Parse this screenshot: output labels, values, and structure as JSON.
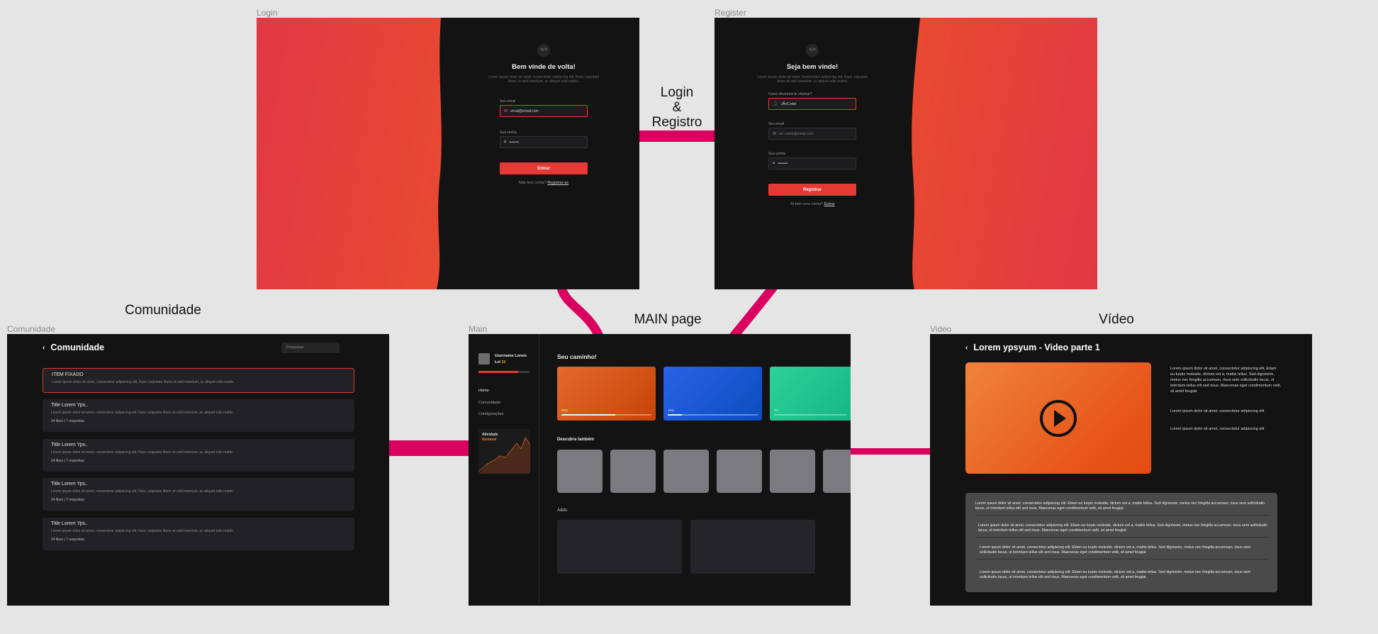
{
  "frames": {
    "login": "Login",
    "register": "Register",
    "community": "Comunidade",
    "main": "Main",
    "video": "Video"
  },
  "annotations": {
    "login_registro": [
      "Login",
      "&",
      "Registro"
    ],
    "comunidade": "Comunidade",
    "main_page": "MAIN page",
    "video": "Vídeo"
  },
  "colors": {
    "accent": "#e53935",
    "connector": "#d9005f",
    "panel": "#131313"
  },
  "login": {
    "logo": "</>",
    "title": "Bem vinde de volta!",
    "subtitle": "Lorem ipsum dolor sit amet, consectetur adipiscing elit. Nunc vulputate libero et velit interdum, ac aliquet odio mattis.",
    "email_label": "Seu email",
    "email_value": "email@email.com",
    "password_label": "Sua senha",
    "password_value": "••••••••",
    "button": "Entrar",
    "footer_text": "Não tem conta?",
    "footer_link": "Registrar-se"
  },
  "register": {
    "logo": "</>",
    "title": "Seja bem vinde!",
    "subtitle": "Lorem ipsum dolor sit amet, consectetur adipiscing elit. Nunc vulputate libero et velit interdum, ac aliquet odio mattis.",
    "name_label": "Como devemos te chamar?",
    "name_value": "JÃoCoder",
    "email_label": "Seu email",
    "email_value": "ex: nome@email.com",
    "password_label": "Sua senha",
    "password_value": "••••••••",
    "button": "Registrar",
    "footer_text": "Já tem uma conta?",
    "footer_link": "Entrar"
  },
  "community": {
    "back_icon": "chevron-left-icon",
    "title": "Comunidade",
    "search_placeholder": "Pesquisar",
    "pinned": {
      "title": "ITEM FIXADO",
      "body": "Lorem ipsum dolor sit amet, consectetur adipiscing elit. Nunc vulputate libero et velit interdum, ac aliquet odio mattis."
    },
    "items": [
      {
        "title": "Title Lorem Yps..",
        "body": "Lorem ipsum dolor sit amet, consectetur adipiscing elit. Nunc vulputate libero et velit interdum, ac aliquet odio mattis.",
        "meta": "24 likes | 7 respostas"
      },
      {
        "title": "Title Lorem Yps..",
        "body": "Lorem ipsum dolor sit amet, consectetur adipiscing elit. Nunc vulputate libero et velit interdum, ac aliquet odio mattis.",
        "meta": "24 likes | 7 respostas"
      },
      {
        "title": "Title Lorem Yps..",
        "body": "Lorem ipsum dolor sit amet, consectetur adipiscing elit. Nunc vulputate libero et velit interdum, ac aliquet odio mattis.",
        "meta": "24 likes | 7 respostas"
      },
      {
        "title": "Title Lorem Yps..",
        "body": "Lorem ipsum dolor sit amet, consectetur adipiscing elit. Nunc vulputate libero et velit interdum, ac aliquet odio mattis.",
        "meta": "24 likes | 7 respostas"
      }
    ]
  },
  "main": {
    "username": "Username Lorem",
    "level_prefix": "Lvl",
    "level_value": "32",
    "xp_progress": 0.78,
    "nav": [
      "Home",
      "Comunidade",
      "Configurações"
    ],
    "activity_title": "Atividade",
    "activity_period": "Semanal",
    "path_title": "Seu caminho!",
    "path_cards": [
      {
        "percent": "60%",
        "progress": 0.6,
        "color_from": "#e4692d",
        "color_to": "#c74306"
      },
      {
        "percent": "16%",
        "progress": 0.16,
        "color_from": "#2b61e6",
        "color_to": "#0a4ec0"
      },
      {
        "percent": "0%",
        "progress": 0.0,
        "color_from": "#2ed19a",
        "color_to": "#16b683"
      }
    ],
    "discover_title": "Descubra também",
    "add_title": "Adds:"
  },
  "video": {
    "back_icon": "chevron-left-icon",
    "title": "Lorem ypsyum - Video parte 1",
    "play_icon": "play-icon",
    "side_texts": [
      "Lorem ipsum dolor sit amet, consectetur adipiscing elit. Etiam eu turpis molestie, dictum est a, mattis tellus. Sed dignissim, metus nec fringilla accumsan, risus sem sollicitudin lacus, ut interdum tellus elit sed risus. Maecenas eget condimentum velit, sit amet feugiat",
      "Lorem ipsum dolor sit amet, consectetur adipiscing elit",
      "Lorem ipsum dolor sit amet, consectetur adipiscing elit"
    ],
    "paragraphs": [
      "Lorem ipsum dolor sit amet, consectetur adipiscing elit. Etiam eu turpis molestie, dictum est a, mattis tellus. Sed dignissim, metus nec fringilla accumsan, risus sem sollicitudin lacus, ut interdum tellus elit sed risus. Maecenas eget condimentum velit, sit amet feugiat",
      "Lorem ipsum dolor sit amet, consectetur adipiscing elit. Etiam eu turpis molestie, dictum est a, mattis tellus. Sed dignissim, metus nec fringilla accumsan, risus sem sollicitudin lacus, ut interdum tellus elit sed risus. Maecenas eget condimentum velit, sit amet feugiat",
      "Lorem ipsum dolor sit amet, consectetur adipiscing elit. Etiam eu turpis molestie, dictum est a, mattis tellus. Sed dignissim, metus nec fringilla accumsan, risus sem sollicitudin lacus, ut interdum tellus elit sed risus. Maecenas eget condimentum velit, sit amet feugiat",
      "Lorem ipsum dolor sit amet, consectetur adipiscing elit. Etiam eu turpis molestie, dictum est a, mattis tellus. Sed dignissim, metus nec fringilla accumsan, risus sem sollicitudin lacus, ut interdum tellus elit sed risus. Maecenas eget condimentum velit, sit amet feugiat"
    ]
  }
}
